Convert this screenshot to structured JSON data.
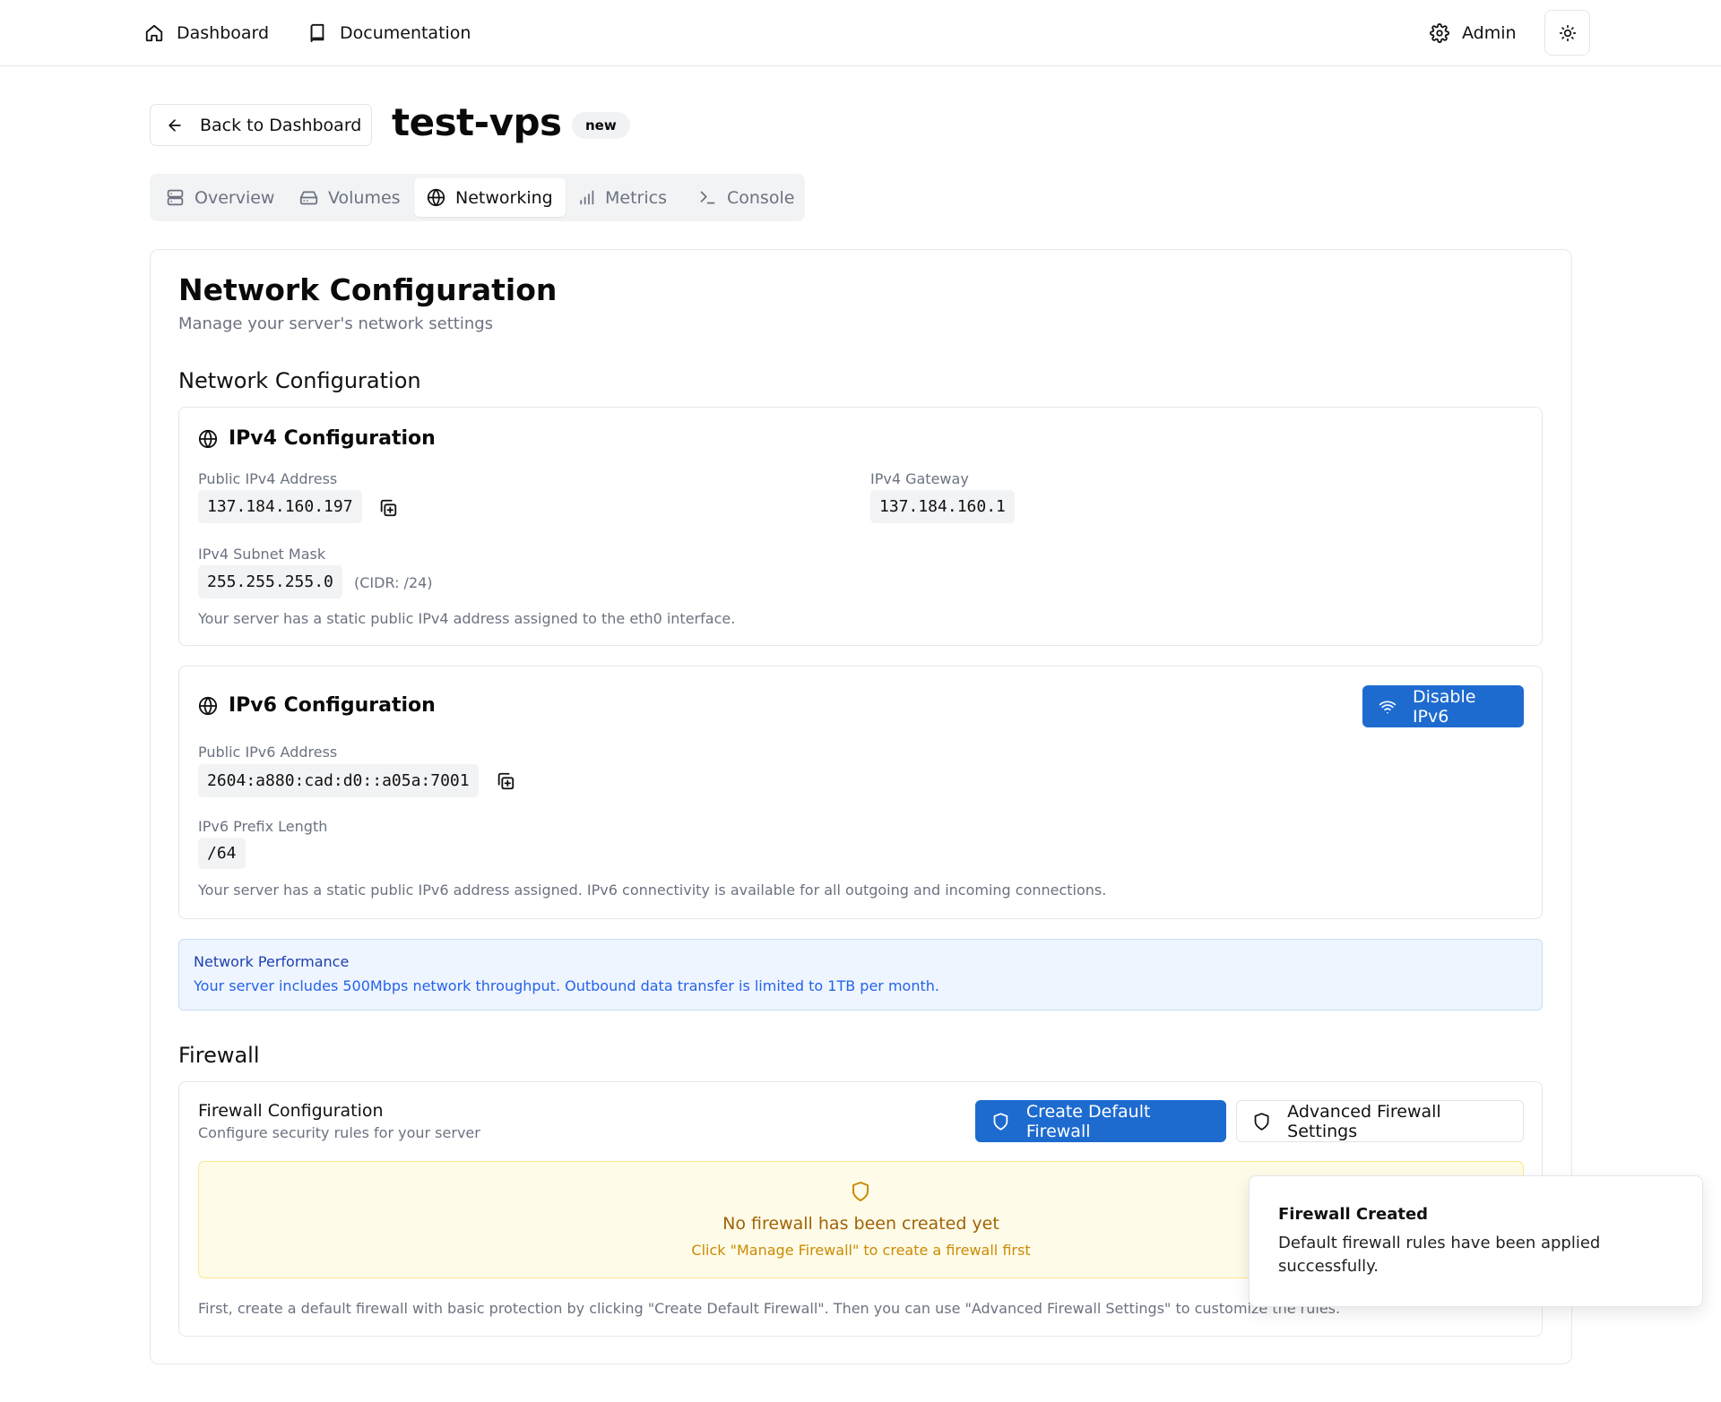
{
  "nav": {
    "dashboard": "Dashboard",
    "documentation": "Documentation",
    "admin": "Admin"
  },
  "header": {
    "back_label": "Back to Dashboard",
    "server_name": "test-vps",
    "status_badge": "new"
  },
  "tabs": [
    {
      "label": "Overview",
      "icon": "server-icon"
    },
    {
      "label": "Volumes",
      "icon": "hard-drive-icon"
    },
    {
      "label": "Networking",
      "icon": "globe-icon",
      "active": true
    },
    {
      "label": "Metrics",
      "icon": "bar-chart-icon"
    },
    {
      "label": "Console",
      "icon": "terminal-icon"
    }
  ],
  "main": {
    "title": "Network Configuration",
    "subtitle": "Manage your server's network settings",
    "section_network": "Network Configuration",
    "section_firewall": "Firewall"
  },
  "ipv4": {
    "title": "IPv4 Configuration",
    "address_label": "Public IPv4 Address",
    "address": "137.184.160.197",
    "gateway_label": "IPv4 Gateway",
    "gateway": "137.184.160.1",
    "subnet_label": "IPv4 Subnet Mask",
    "subnet": "255.255.255.0",
    "cidr": "(CIDR: /24)",
    "note": "Your server has a static public IPv4 address assigned to the eth0 interface."
  },
  "ipv6": {
    "title": "IPv6 Configuration",
    "disable_label": "Disable IPv6",
    "address_label": "Public IPv6 Address",
    "address": "2604:a880:cad:d0::a05a:7001",
    "prefix_label": "IPv6 Prefix Length",
    "prefix": "/64",
    "note": "Your server has a static public IPv6 address assigned. IPv6 connectivity is available for all outgoing and incoming connections."
  },
  "performance": {
    "title": "Network Performance",
    "text": "Your server includes 500Mbps network throughput. Outbound data transfer is limited to 1TB per month."
  },
  "firewall": {
    "config_title": "Firewall Configuration",
    "config_sub": "Configure security rules for your server",
    "create_label": "Create Default Firewall",
    "advanced_label": "Advanced Firewall Settings",
    "empty_title": "No firewall has been created yet",
    "empty_sub": "Click \"Manage Firewall\" to create a firewall first",
    "note": "First, create a default firewall with basic protection by clicking \"Create Default Firewall\". Then you can use \"Advanced Firewall Settings\" to customize the rules."
  },
  "toast": {
    "title": "Firewall Created",
    "text": "Default firewall rules have been applied successfully."
  },
  "colors": {
    "primary": "#1e6bd0",
    "info_bg": "#eff5fe",
    "warning_bg": "#fefce8",
    "warning_text": "#a16207"
  }
}
